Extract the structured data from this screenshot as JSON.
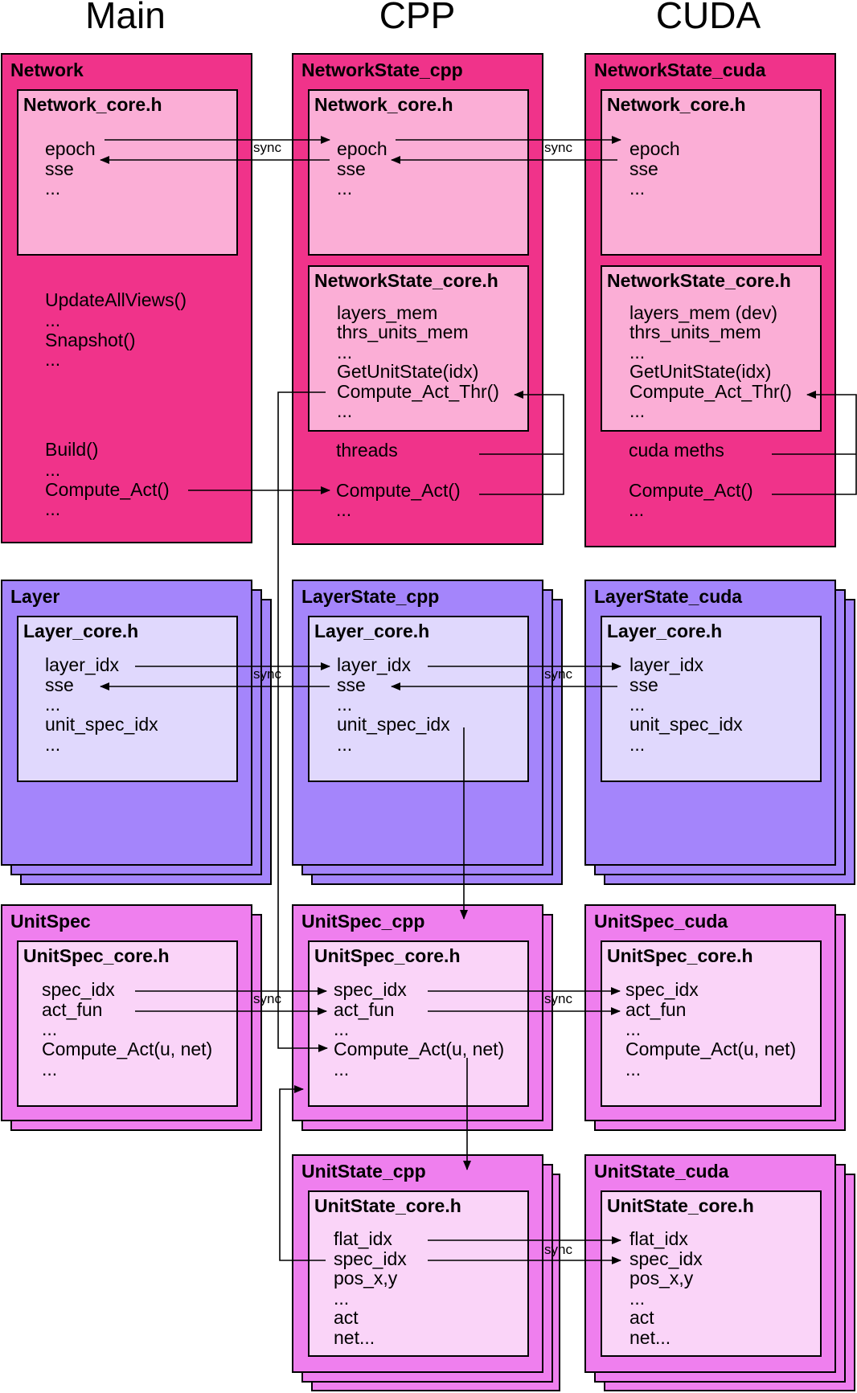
{
  "columns": {
    "main": "Main",
    "cpp": "CPP",
    "cuda": "CUDA"
  },
  "colors": {
    "network_outer": "#f0338a",
    "network_inner": "#fbaed6",
    "layer_outer": "#a485fb",
    "layer_inner": "#e0d8fd",
    "unit_outer": "#ef7fee",
    "unit_inner": "#fad4f8"
  },
  "sync_label": "sync",
  "network": {
    "main": {
      "title": "Network",
      "core_title": "Network_core.h",
      "core_lines": [
        "epoch",
        "sse",
        "..."
      ],
      "extra_lines": [
        "UpdateAllViews()",
        "...",
        "Snapshot()",
        "...",
        "",
        "",
        "Build()",
        "...",
        "Compute_Act()",
        "..."
      ]
    },
    "cpp": {
      "title": "NetworkState_cpp",
      "core_title": "Network_core.h",
      "core_lines": [
        "epoch",
        "sse",
        "..."
      ],
      "state_title": "NetworkState_core.h",
      "state_lines": [
        "layers_mem",
        "thrs_units_mem",
        "...",
        "GetUnitState(idx)",
        "Compute_Act_Thr()",
        "..."
      ],
      "extra_lines": [
        "threads",
        "",
        "Compute_Act()",
        "..."
      ]
    },
    "cuda": {
      "title": "NetworkState_cuda",
      "core_title": "Network_core.h",
      "core_lines": [
        "epoch",
        "sse",
        "..."
      ],
      "state_title": "NetworkState_core.h",
      "state_lines": [
        "layers_mem  (dev)",
        "thrs_units_mem",
        "...",
        "GetUnitState(idx)",
        "Compute_Act_Thr()",
        "..."
      ],
      "extra_lines": [
        "cuda meths",
        "",
        "Compute_Act()",
        "..."
      ]
    }
  },
  "layer": {
    "main": {
      "title": "Layer",
      "core_title": "Layer_core.h",
      "core_lines": [
        "layer_idx",
        "sse",
        "...",
        "unit_spec_idx",
        "..."
      ]
    },
    "cpp": {
      "title": "LayerState_cpp",
      "core_title": "Layer_core.h",
      "core_lines": [
        "layer_idx",
        "sse",
        "...",
        "unit_spec_idx",
        "..."
      ]
    },
    "cuda": {
      "title": "LayerState_cuda",
      "core_title": "Layer_core.h",
      "core_lines": [
        "layer_idx",
        "sse",
        "...",
        "unit_spec_idx",
        "..."
      ]
    }
  },
  "unitspec": {
    "main": {
      "title": "UnitSpec",
      "core_title": "UnitSpec_core.h",
      "core_lines": [
        "spec_idx",
        "act_fun",
        "...",
        "Compute_Act(u, net)",
        "..."
      ]
    },
    "cpp": {
      "title": "UnitSpec_cpp",
      "core_title": "UnitSpec_core.h",
      "core_lines": [
        "spec_idx",
        "act_fun",
        "...",
        "Compute_Act(u, net)",
        "..."
      ]
    },
    "cuda": {
      "title": "UnitSpec_cuda",
      "core_title": "UnitSpec_core.h",
      "core_lines": [
        "spec_idx",
        "act_fun",
        "...",
        "Compute_Act(u, net)",
        "..."
      ]
    }
  },
  "unitstate": {
    "cpp": {
      "title": "UnitState_cpp",
      "core_title": "UnitState_core.h",
      "core_lines": [
        "flat_idx",
        "spec_idx",
        "pos_x,y",
        "...",
        "act",
        "net..."
      ]
    },
    "cuda": {
      "title": "UnitState_cuda",
      "core_title": "UnitState_core.h",
      "core_lines": [
        "flat_idx",
        "spec_idx",
        "pos_x,y",
        "...",
        "act",
        "net..."
      ]
    }
  }
}
